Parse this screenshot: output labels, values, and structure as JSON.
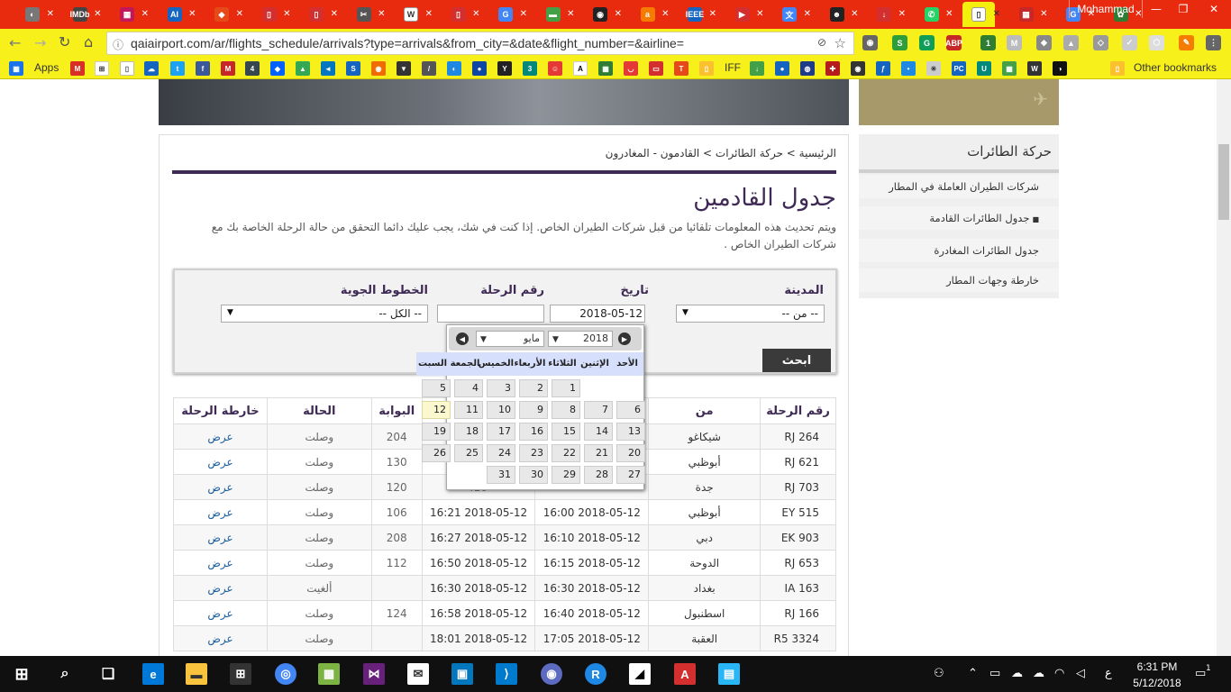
{
  "browser": {
    "profile_name": "Mohammad",
    "url": "qaiairport.com/ar/flights_schedule/arrivals?type=arrivals&from_city=&date&flight_number=&airline=",
    "bookmarks": {
      "apps_label": "Apps",
      "iff_label": "IFF",
      "other_label": "Other bookmarks"
    },
    "colors": {
      "tabstrip": "#e82a0f",
      "toolbar": "#f7f01a"
    }
  },
  "breadcrumb": "الرئيسية > حركة الطائرات > القادمون - المغادرون",
  "page_title": "جدول القادمين",
  "description": "ويتم تحديث هذه المعلومات تلقائيا من قبل شركات الطيران الخاص. إذا كنت في شك، يجب عليك دائما التحقق من حالة الرحلة الخاصة بك مع شركات الطيران الخاص .",
  "filters": {
    "city_label": "المدينة",
    "city_value": "-- من --",
    "date_label": "تاريخ",
    "date_value": "2018-05-12",
    "flight_label": "رقم الرحلة",
    "flight_value": "",
    "airline_label": "الخطوط الجوية",
    "airline_value": "-- الكل --",
    "search_label": "ابحث"
  },
  "datepicker": {
    "month": "مايو",
    "year": "2018",
    "weekdays": [
      "الأحد",
      "الإثنين",
      "الثلاثاء",
      "الأربعاء",
      "الخميس",
      "الجمعة",
      "السبت"
    ],
    "selected_day": "12",
    "weeks": [
      [
        "",
        "",
        "1",
        "2",
        "3",
        "4",
        "5"
      ],
      [
        "6",
        "7",
        "8",
        "9",
        "10",
        "11",
        "12"
      ],
      [
        "13",
        "14",
        "15",
        "16",
        "17",
        "18",
        "19"
      ],
      [
        "20",
        "21",
        "22",
        "23",
        "24",
        "25",
        "26"
      ],
      [
        "27",
        "28",
        "29",
        "30",
        "31",
        "",
        ""
      ]
    ]
  },
  "table": {
    "headers": [
      "رقم الرحلة",
      "من",
      "",
      "",
      "البوابة",
      "الحالة",
      "خارطة الرحلة"
    ],
    "rows": [
      [
        "RJ 264",
        "شيكاغو",
        "",
        "",
        "204",
        "وصلت",
        "عرض"
      ],
      [
        "RJ 621",
        "أبوظبي",
        "",
        "",
        "130",
        "وصلت",
        "عرض"
      ],
      [
        "RJ 703",
        "جدة",
        "",
        "16:",
        "120",
        "وصلت",
        "عرض"
      ],
      [
        "EY 515",
        "أبوظبي",
        "2018-05-12 16:00",
        "2018-05-12 16:21",
        "106",
        "وصلت",
        "عرض"
      ],
      [
        "EK 903",
        "دبي",
        "2018-05-12 16:10",
        "2018-05-12 16:27",
        "208",
        "وصلت",
        "عرض"
      ],
      [
        "RJ 653",
        "الدوحة",
        "2018-05-12 16:15",
        "2018-05-12 16:50",
        "112",
        "وصلت",
        "عرض"
      ],
      [
        "IA 163",
        "بغداد",
        "2018-05-12 16:30",
        "2018-05-12 16:30",
        "",
        "ألغيت",
        "عرض"
      ],
      [
        "RJ 166",
        "اسطنبول",
        "2018-05-12 16:40",
        "2018-05-12 16:58",
        "124",
        "وصلت",
        "عرض"
      ],
      [
        "R5 3324",
        "العقبة",
        "2018-05-12 17:05",
        "2018-05-12 18:01",
        "",
        "وصلت",
        "عرض"
      ]
    ]
  },
  "sidebar": {
    "title": "حركة الطائرات",
    "items": [
      {
        "label": "شركات الطيران العاملة في المطار"
      },
      {
        "label": "جدول الطائرات القادمة"
      },
      {
        "label": "جدول الطائرات المغادرة"
      },
      {
        "label": "خارطة وجهات المطار"
      }
    ]
  },
  "taskbar": {
    "time": "6:31 PM",
    "date": "5/12/2018",
    "lang": "ع",
    "notification_count": "1"
  }
}
